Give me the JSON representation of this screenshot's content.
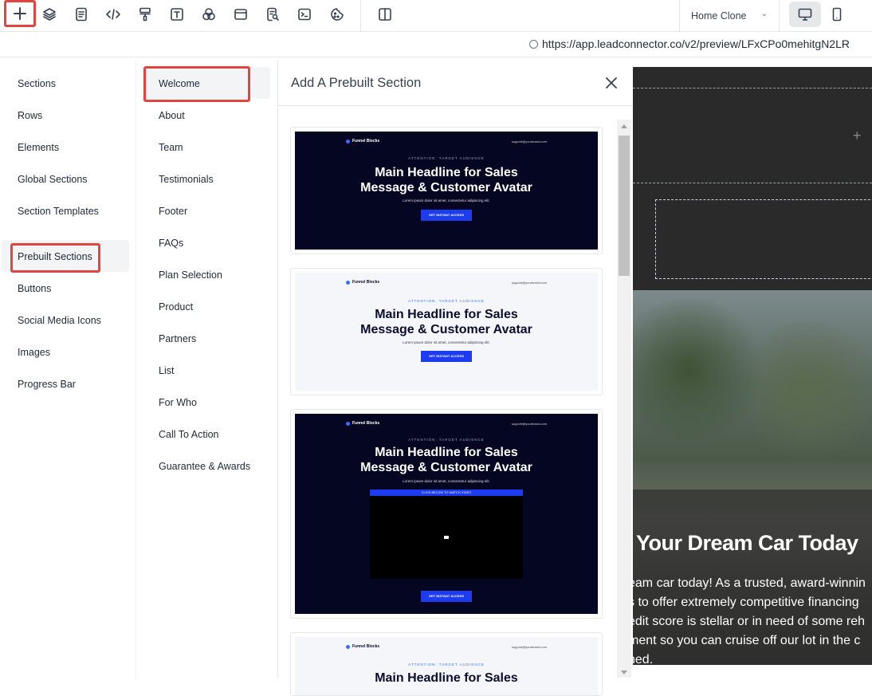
{
  "toolbar": {
    "buttons": [
      "add-icon",
      "layers-icon",
      "page-icon",
      "code-icon",
      "paint-roller-icon",
      "text-icon",
      "colors-icon",
      "layout-icon",
      "search-doc-icon",
      "terminal-icon",
      "cookie-icon",
      "split-view-icon"
    ],
    "page_name": "Home Clone",
    "devices": [
      "desktop-icon",
      "mobile-icon"
    ]
  },
  "url": "https://app.leadconnector.co/v2/preview/LFxCPo0mehitgN2LR",
  "categories": [
    {
      "label": "Sections"
    },
    {
      "label": "Rows"
    },
    {
      "label": "Elements"
    },
    {
      "label": "Global Sections"
    },
    {
      "label": "Section Templates"
    },
    {
      "label": "Prebuilt Sections",
      "active": true
    },
    {
      "label": "Buttons"
    },
    {
      "label": "Social Media Icons"
    },
    {
      "label": "Images"
    },
    {
      "label": "Progress Bar"
    }
  ],
  "subcategories": [
    {
      "label": "Welcome",
      "active": true
    },
    {
      "label": "About"
    },
    {
      "label": "Team"
    },
    {
      "label": "Testimonials"
    },
    {
      "label": "Footer"
    },
    {
      "label": "FAQs"
    },
    {
      "label": "Plan Selection"
    },
    {
      "label": "Product"
    },
    {
      "label": "Partners"
    },
    {
      "label": "List"
    },
    {
      "label": "For Who"
    },
    {
      "label": "Call To Action"
    },
    {
      "label": "Guarantee & Awards"
    }
  ],
  "dialog": {
    "title": "Add A Prebuilt Section",
    "close_icon": "close-icon"
  },
  "templates": [
    {
      "theme": "dark",
      "brand": "Funnel Blocks",
      "email": "support@yourbrand.com",
      "attention": "ATTENTION: TARGET AUDIENCE",
      "headline_1": "Main Headline for Sales",
      "headline_2": "Message & Customer Avatar",
      "subtext": "Lorem ipsum dolor sit amet, consectetur adipiscing elit.",
      "cta": "GET INSTANT ACCESS"
    },
    {
      "theme": "light",
      "brand": "Funnel Blocks",
      "email": "support@yourbrand.com",
      "attention": "ATTENTION: TARGET AUDIENCE",
      "headline_1": "Main Headline for Sales",
      "headline_2": "Message & Customer Avatar",
      "subtext": "Lorem ipsum dolor sit amet, consectetur adipiscing elit.",
      "cta": "GET INSTANT ACCESS"
    },
    {
      "theme": "dark",
      "brand": "Funnel Blocks",
      "email": "support@yourbrand.com",
      "attention": "ATTENTION: TARGET AUDIENCE",
      "headline_1": "Main Headline for Sales",
      "headline_2": "Message & Customer Avatar",
      "subtext": "Lorem ipsum dolor sit amet, consectetur adipiscing elit.",
      "video_bar": "CLICK BELOW TO WATCH VIDEO",
      "cta": "GET INSTANT ACCESS"
    },
    {
      "theme": "light",
      "brand": "Funnel Blocks",
      "email": "support@yourbrand.com",
      "attention": "ATTENTION: TARGET AUDIENCE",
      "headline_1": "Main Headline for Sales"
    }
  ],
  "preview": {
    "heading": "Your Dream Car Today",
    "body": "eam car today! As a trusted, award-winnin\ns to offer extremely competitive financing\nedit score is stellar or in need of some reh\nment so you can cruise off our lot in the c\nned."
  },
  "colors": {
    "highlight": "#e0463f",
    "cta": "#1d3cf0",
    "thumb_dark": "#040622"
  }
}
